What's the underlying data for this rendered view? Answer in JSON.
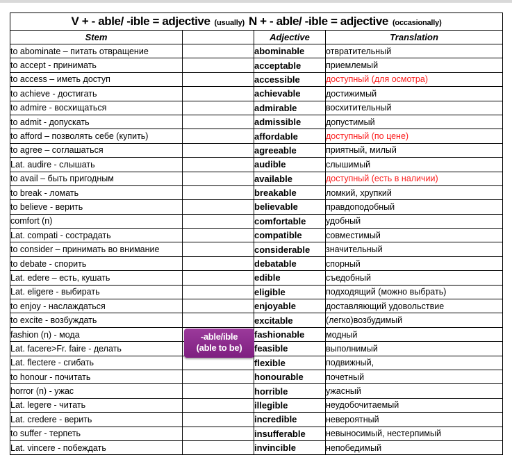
{
  "title_row": {
    "verb_rule": "V + - able/ -ible = adjective",
    "verb_note": "(usually)",
    "noun_rule": "N + - able/ -ible = adjective",
    "noun_note": "(occasionally)"
  },
  "headers": {
    "stem": "Stem",
    "middle": "",
    "adjective": "Adjective",
    "translation": "Translation"
  },
  "badge": {
    "line1": "-able/ible",
    "line2": "(able to be)",
    "color": "#8f2d8f"
  },
  "colors": {
    "red": "#fb1c1c",
    "text": "#000000",
    "border": "#000000"
  },
  "rows": [
    {
      "stem": "to abominate – питать отвращение",
      "adjective": "abominable",
      "translation": "отвратительный",
      "red": false
    },
    {
      "stem": "to accept - принимать",
      "adjective": "acceptable",
      "translation": "приемлемый",
      "red": false
    },
    {
      "stem": "to access – иметь доступ",
      "adjective": "accessible",
      "translation": "доступный (для осмотра)",
      "red": true
    },
    {
      "stem": "to achieve - достигать",
      "adjective": "achievable",
      "translation": "достижимый",
      "red": false
    },
    {
      "stem": "to admire - восхищаться",
      "adjective": "admirable",
      "translation": "восхитительный",
      "red": false
    },
    {
      "stem": "to admit - допускать",
      "adjective": "admissible",
      "translation": "допустимый",
      "red": false
    },
    {
      "stem": "to afford – позволять себе (купить)",
      "adjective": "affordable",
      "translation": "доступный (по цене)",
      "red": true
    },
    {
      "stem": "to agree – соглашаться",
      "adjective": "agreeable",
      "translation": "приятный, милый",
      "red": false
    },
    {
      "stem": "Lat. audire - слышать",
      "adjective": "audible",
      "translation": "слышимый",
      "red": false
    },
    {
      "stem": "to avail – быть пригодным",
      "adjective": "available",
      "translation": "доступный (есть в наличии)",
      "red": true
    },
    {
      "stem": "to break - ломать",
      "adjective": "breakable",
      "translation": "ломкий, хрупкий",
      "red": false
    },
    {
      "stem": "to believe - верить",
      "adjective": "believable",
      "translation": "правдоподобный",
      "red": false
    },
    {
      "stem": "comfort (n)",
      "adjective": "comfortable",
      "translation": "удобный",
      "red": false
    },
    {
      "stem": "Lat. compati - сострадать",
      "adjective": "compatible",
      "translation": "совместимый",
      "red": false
    },
    {
      "stem": "to consider – принимать во внимание",
      "adjective": "considerable",
      "translation": "значительный",
      "red": false
    },
    {
      "stem": "to debate - спорить",
      "adjective": "debatable",
      "translation": "спорный",
      "red": false
    },
    {
      "stem": "Lat. edere – есть, кушать",
      "adjective": "edible",
      "translation": "съедобный",
      "red": false
    },
    {
      "stem": "Lat. eligere - выбирать",
      "adjective": "eligible",
      "translation": "подходящий (можно выбрать)",
      "red": false
    },
    {
      "stem": "to enjoy - наслаждаться",
      "adjective": "enjoyable",
      "translation": "доставляющий удовольствие",
      "red": false
    },
    {
      "stem": "to excite - возбуждать",
      "adjective": "excitable",
      "translation": "(легко)возбудимый",
      "red": false
    },
    {
      "stem": "fashion (n) - мода",
      "adjective": "fashionable",
      "translation": "модный",
      "red": false
    },
    {
      "stem": "Lat. facere>Fr. faire - делать",
      "adjective": "feasible",
      "translation": "выполнимый",
      "red": false
    },
    {
      "stem": "Lat. flectere - сгибать",
      "adjective": "flexible",
      "translation": "подвижный,",
      "red": false
    },
    {
      "stem": "to honour - почитать",
      "adjective": "honourable",
      "translation": "почетный",
      "red": false
    },
    {
      "stem": "horror (n) - ужас",
      "adjective": "horrible",
      "translation": "ужасный",
      "red": false
    },
    {
      "stem": "Lat. legere - читать",
      "adjective": "illegible",
      "translation": "неудобочитаемый",
      "red": false
    },
    {
      "stem": "Lat. credere - верить",
      "adjective": "incredible",
      "translation": "невероятный",
      "red": false
    },
    {
      "stem": "to suffer - терпеть",
      "adjective": "insufferable",
      "translation": "невыносимый, нестерпимый",
      "red": false
    },
    {
      "stem": "Lat. vincere - побеждать",
      "adjective": "invincible",
      "translation": "непобедимый",
      "red": false
    }
  ]
}
